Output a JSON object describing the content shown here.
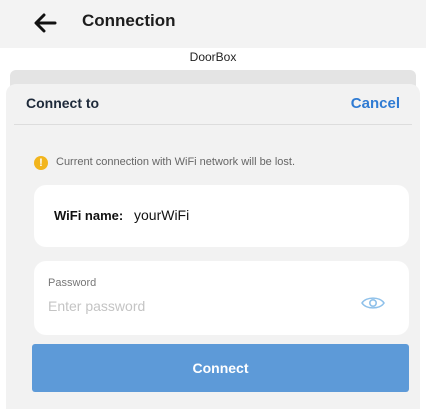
{
  "header": {
    "back_icon": "arrow-left-icon",
    "title": "Connection",
    "device_name": "DoorBox"
  },
  "sheet": {
    "title": "Connect to",
    "cancel_label": "Cancel",
    "warning": {
      "icon": "warning-icon",
      "icon_glyph": "!",
      "text": "Current connection with WiFi network will be lost."
    },
    "wifi": {
      "label": "WiFi name:",
      "value": "yourWiFi"
    },
    "password": {
      "label": "Password",
      "placeholder": "Enter password",
      "value": "",
      "visibility_icon": "eye-icon"
    },
    "connect_label": "Connect"
  },
  "colors": {
    "accent": "#2f7bd3",
    "button": "#5d9ad8",
    "warning": "#f2b51d"
  }
}
